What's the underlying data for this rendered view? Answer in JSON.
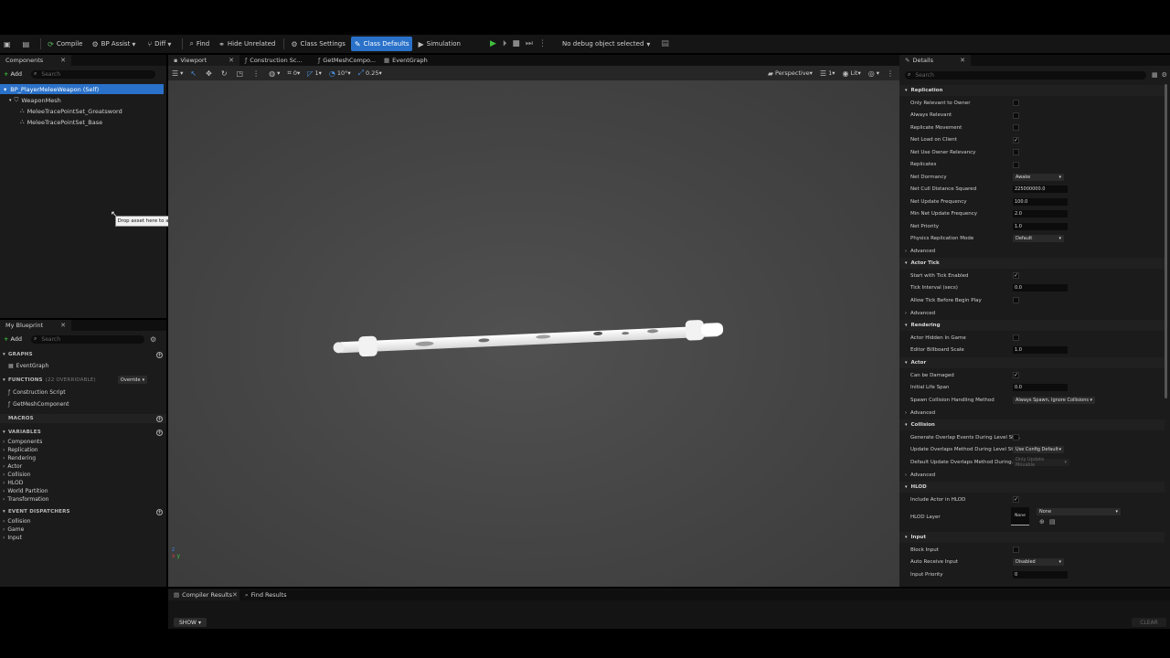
{
  "toolbar": {
    "compile": "Compile",
    "bp_assist": "BP Assist",
    "diff": "Diff",
    "find": "Find",
    "hide_unrelated": "Hide Unrelated",
    "class_settings": "Class Settings",
    "class_defaults": "Class Defaults",
    "simulation": "Simulation",
    "debug_select": "No debug object selected"
  },
  "components": {
    "tab": "Components",
    "add": "Add",
    "search_placeholder": "Search",
    "tree": [
      {
        "label": "BP_PlayerMeleeWeapon (Self)"
      },
      {
        "label": "WeaponMesh"
      },
      {
        "label": "MeleeTracePointSet_Greatsword"
      },
      {
        "label": "MeleeTracePointSet_Base"
      }
    ],
    "tooltip": "Drop asset here to add a component"
  },
  "my_blueprint": {
    "tab": "My Blueprint",
    "add": "Add",
    "search_placeholder": "Search",
    "graphs_header": "GRAPHS",
    "graphs": [
      "EventGraph"
    ],
    "functions_header": "FUNCTIONS",
    "functions_count": "(22 OVERRIDABLE)",
    "override": "Override",
    "functions": [
      "Construction Script",
      "GetMeshComponent"
    ],
    "macros_header": "MACROS",
    "variables_header": "VARIABLES",
    "variables": [
      "Components",
      "Replication",
      "Rendering",
      "Actor",
      "Collision",
      "HLOD",
      "World Partition",
      "Transformation"
    ],
    "dispatchers_header": "EVENT DISPATCHERS",
    "dispatchers": [
      "Collision",
      "Game",
      "Input"
    ]
  },
  "editor_tabs": [
    "Viewport",
    "Construction Sc...",
    "GetMeshCompo...",
    "EventGraph"
  ],
  "viewport": {
    "view_mode": "Perspective",
    "lit": "Lit",
    "fov": "1",
    "snap_rot": "10°",
    "snap_scale": "0.25",
    "snap_grid": "0"
  },
  "details": {
    "tab": "Details",
    "search_placeholder": "Search",
    "sections": {
      "replication": "Replication",
      "actor_tick": "Actor Tick",
      "rendering": "Rendering",
      "actor": "Actor",
      "collision": "Collision",
      "hlod": "HLOD",
      "input": "Input"
    },
    "advanced": "Advanced",
    "props": {
      "only_relevant": "Only Relevant to Owner",
      "always_relevant": "Always Relevant",
      "replicate_movement": "Replicate Movement",
      "net_load_client": "Net Load on Client",
      "net_use_owner": "Net Use Owner Relevancy",
      "replicates": "Replicates",
      "net_dormancy": "Net Dormancy",
      "net_dormancy_val": "Awake",
      "net_cull": "Net Cull Distance Squared",
      "net_cull_val": "225000000.0",
      "net_update": "Net Update Frequency",
      "net_update_val": "100.0",
      "min_net_update": "Min Net Update Frequency",
      "min_net_update_val": "2.0",
      "net_priority": "Net Priority",
      "net_priority_val": "1.0",
      "physics_rep": "Physics Replication Mode",
      "physics_rep_val": "Default",
      "start_tick": "Start with Tick Enabled",
      "tick_interval": "Tick Interval (secs)",
      "tick_interval_val": "0.0",
      "allow_tick": "Allow Tick Before Begin Play",
      "hidden_game": "Actor Hidden In Game",
      "billboard": "Editor Billboard Scale",
      "billboard_val": "1.0",
      "can_damage": "Can be Damaged",
      "life_span": "Initial Life Span",
      "life_span_val": "0.0",
      "spawn_collision": "Spawn Collision Handling Method",
      "spawn_collision_val": "Always Spawn, Ignore Collisions",
      "gen_overlap": "Generate Overlap Events During Level Str...",
      "update_overlap": "Update Overlaps Method During Level Str...",
      "update_overlap_val": "Use Config Default",
      "default_update": "Default Update Overlaps Method During...",
      "default_update_val": "Only Update Movable",
      "include_hlod": "Include Actor in HLOD",
      "hlod_layer": "HLOD Layer",
      "hlod_none": "None",
      "hlod_combo_val": "None",
      "block_input": "Block Input",
      "auto_receive": "Auto Receive Input",
      "auto_receive_val": "Disabled",
      "input_priority": "Input Priority",
      "input_priority_val": "0"
    }
  },
  "bottom": {
    "compiler_results": "Compiler Results",
    "find_results": "Find Results",
    "show": "SHOW",
    "clear": "CLEAR"
  }
}
